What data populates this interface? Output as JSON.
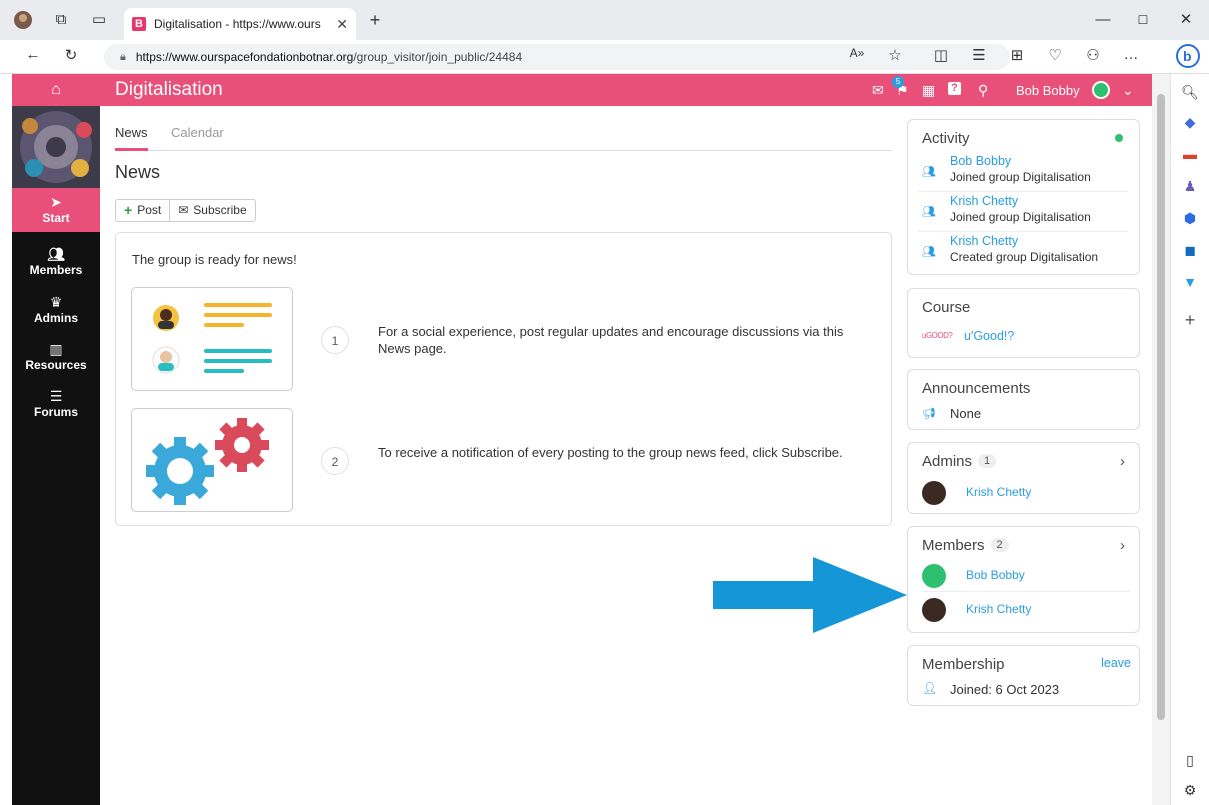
{
  "browser": {
    "tab_title": "Digitalisation - https://www.ours",
    "tab_favicon_letter": "B",
    "new_tab_label": "+",
    "url_host": "https://www.ourspacefondationbotnar.org",
    "url_path": "/group_visitor/join_public/24484"
  },
  "header": {
    "title": "Digitalisation",
    "notification_count": "5",
    "username": "Bob Bobby"
  },
  "nav": {
    "items": [
      {
        "label": "Start",
        "icon": "send-icon"
      },
      {
        "label": "Members",
        "icon": "users-icon"
      },
      {
        "label": "Admins",
        "icon": "crown-icon"
      },
      {
        "label": "Resources",
        "icon": "books-icon"
      },
      {
        "label": "Forums",
        "icon": "list-icon"
      }
    ]
  },
  "main": {
    "tabs": [
      "News",
      "Calendar"
    ],
    "heading": "News",
    "post_label": "Post",
    "subscribe_label": "Subscribe",
    "ready_text": "The group is ready for news!",
    "steps": [
      {
        "num": "1",
        "text": "For a social experience, post regular updates and encourage discussions via this News page."
      },
      {
        "num": "2",
        "text": "To receive a notification of every posting to the group news feed, click Subscribe."
      }
    ]
  },
  "activity": {
    "title": "Activity",
    "items": [
      {
        "name": "Bob Bobby",
        "desc": "Joined group Digitalisation"
      },
      {
        "name": "Krish Chetty",
        "desc": "Joined group Digitalisation"
      },
      {
        "name": "Krish Chetty",
        "desc": "Created group Digitalisation"
      }
    ]
  },
  "course": {
    "title": "Course",
    "logo_text": "uGOOD?",
    "name": "u'Good!?"
  },
  "announcements": {
    "title": "Announcements",
    "value": "None"
  },
  "admins": {
    "title": "Admins",
    "count": "1",
    "members": [
      "Krish Chetty"
    ]
  },
  "members": {
    "title": "Members",
    "count": "2",
    "list": [
      "Bob Bobby",
      "Krish Chetty"
    ]
  },
  "membership": {
    "title": "Membership",
    "leave_label": "leave",
    "joined": "Joined: 6 Oct 2023"
  },
  "colors": {
    "brand": "#e8507a",
    "link": "#2a9de0",
    "arrow": "#1596d6"
  }
}
